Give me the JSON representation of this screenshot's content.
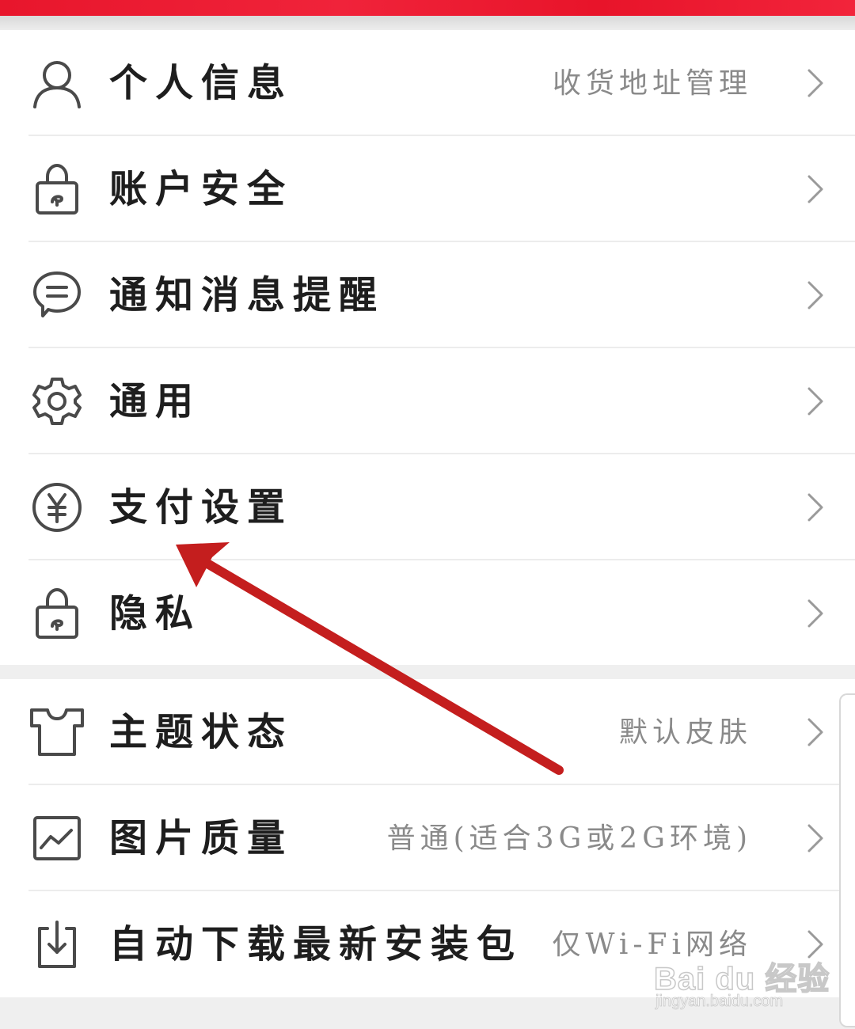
{
  "colors": {
    "banner": "#e8162c",
    "label": "#1e1e1e",
    "value": "#8a8a8a",
    "icon": "#4a4a4a",
    "chevron": "#9a9a9a",
    "arrow": "#c41e1e"
  },
  "settings": {
    "group1": [
      {
        "label": "个人信息",
        "value": "收货地址管理",
        "icon": "user-icon"
      },
      {
        "label": "账户安全",
        "value": "",
        "icon": "lock-icon"
      },
      {
        "label": "通知消息提醒",
        "value": "",
        "icon": "chat-bubble-icon"
      },
      {
        "label": "通用",
        "value": "",
        "icon": "gear-icon"
      },
      {
        "label": "支付设置",
        "value": "",
        "icon": "yen-icon"
      },
      {
        "label": "隐私",
        "value": "",
        "icon": "lock-icon"
      }
    ],
    "group2": [
      {
        "label": "主题状态",
        "value": "默认皮肤",
        "icon": "tshirt-icon"
      },
      {
        "label": "图片质量",
        "value": "普通(适合3G或2G环境)",
        "icon": "image-icon"
      },
      {
        "label": "自动下载最新安装包",
        "value": "仅Wi-Fi网络",
        "icon": "download-icon"
      }
    ]
  },
  "watermark": {
    "logo": "Bai du 经验",
    "url": "jingyan.baidu.com"
  },
  "annotation": {
    "type": "red-arrow",
    "points_to": "支付设置"
  }
}
